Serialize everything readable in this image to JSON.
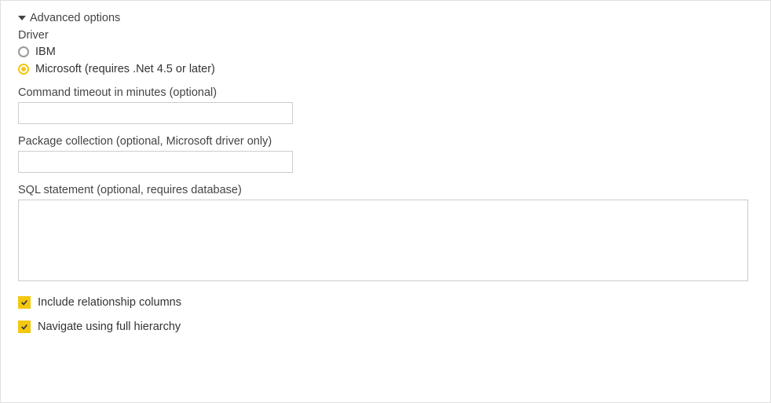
{
  "advanced": {
    "header": "Advanced options",
    "driver_label": "Driver",
    "radio_ibm": "IBM",
    "radio_microsoft": "Microsoft (requires .Net 4.5 or later)",
    "timeout_label": "Command timeout in minutes (optional)",
    "timeout_value": "",
    "package_label": "Package collection (optional, Microsoft driver only)",
    "package_value": "",
    "sql_label": "SQL statement (optional, requires database)",
    "sql_value": "",
    "include_rel_label": "Include relationship columns",
    "navigate_label": "Navigate using full hierarchy"
  },
  "state": {
    "selected_driver": "microsoft",
    "include_relationship_columns": true,
    "navigate_full_hierarchy": true,
    "expanded": true
  }
}
